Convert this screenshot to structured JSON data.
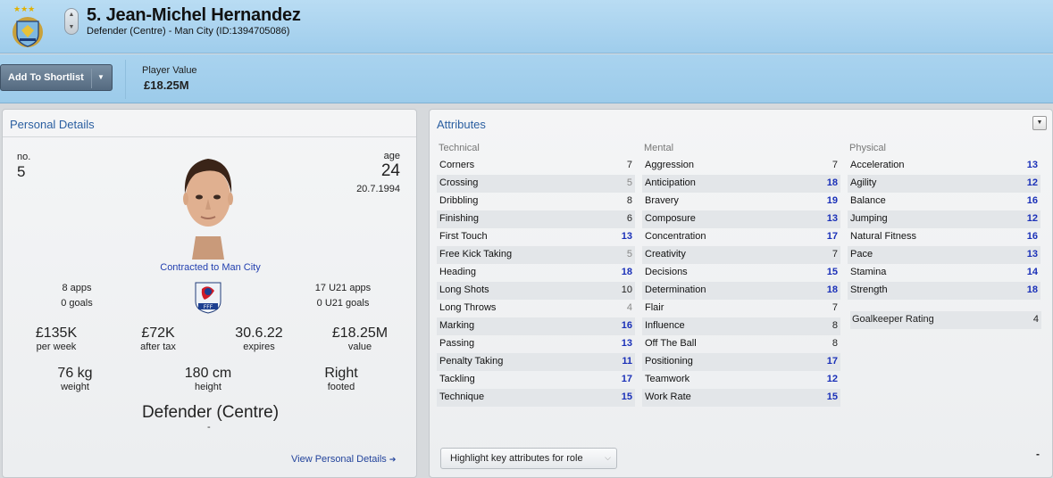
{
  "header": {
    "title": "5. Jean-Michel Hernandez",
    "subtitle": "Defender (Centre) - Man City (ID:1394705086)",
    "crest_icon": "club-crest-icon"
  },
  "toolbar": {
    "shortlist_label": "Add To Shortlist",
    "player_value_label": "Player Value",
    "player_value": "£18.25M"
  },
  "personal": {
    "title": "Personal Details",
    "no_label": "no.",
    "no_value": "5",
    "age_label": "age",
    "age_value": "24",
    "dob": "20.7.1994",
    "contract": "Contracted to Man City",
    "apps": "8 apps",
    "goals": "0 goals",
    "u21_apps": "17 U21 apps",
    "u21_goals": "0 U21 goals",
    "stats": [
      {
        "value": "£135K",
        "caption": "per week"
      },
      {
        "value": "£72K",
        "caption": "after tax"
      },
      {
        "value": "30.6.22",
        "caption": "expires"
      },
      {
        "value": "£18.25M",
        "caption": "value"
      }
    ],
    "physical": [
      {
        "value": "76 kg",
        "caption": "weight"
      },
      {
        "value": "180 cm",
        "caption": "height"
      },
      {
        "value": "Right",
        "caption": "footed"
      }
    ],
    "role": "Defender (Centre)",
    "role_sub": "-",
    "view_link": "View Personal Details",
    "federation_badge": "FFF"
  },
  "attributes": {
    "title": "Attributes",
    "technical": {
      "heading": "Technical",
      "rows": [
        {
          "name": "Corners",
          "value": "7"
        },
        {
          "name": "Crossing",
          "value": "5"
        },
        {
          "name": "Dribbling",
          "value": "8"
        },
        {
          "name": "Finishing",
          "value": "6"
        },
        {
          "name": "First Touch",
          "value": "13"
        },
        {
          "name": "Free Kick Taking",
          "value": "5"
        },
        {
          "name": "Heading",
          "value": "18"
        },
        {
          "name": "Long Shots",
          "value": "10"
        },
        {
          "name": "Long Throws",
          "value": "4"
        },
        {
          "name": "Marking",
          "value": "16"
        },
        {
          "name": "Passing",
          "value": "13"
        },
        {
          "name": "Penalty Taking",
          "value": "11"
        },
        {
          "name": "Tackling",
          "value": "17"
        },
        {
          "name": "Technique",
          "value": "15"
        }
      ]
    },
    "mental": {
      "heading": "Mental",
      "rows": [
        {
          "name": "Aggression",
          "value": "7"
        },
        {
          "name": "Anticipation",
          "value": "18"
        },
        {
          "name": "Bravery",
          "value": "19"
        },
        {
          "name": "Composure",
          "value": "13"
        },
        {
          "name": "Concentration",
          "value": "17"
        },
        {
          "name": "Creativity",
          "value": "7"
        },
        {
          "name": "Decisions",
          "value": "15"
        },
        {
          "name": "Determination",
          "value": "18"
        },
        {
          "name": "Flair",
          "value": "7"
        },
        {
          "name": "Influence",
          "value": "8"
        },
        {
          "name": "Off The Ball",
          "value": "8"
        },
        {
          "name": "Positioning",
          "value": "17"
        },
        {
          "name": "Teamwork",
          "value": "12"
        },
        {
          "name": "Work Rate",
          "value": "15"
        }
      ]
    },
    "physical": {
      "heading": "Physical",
      "rows": [
        {
          "name": "Acceleration",
          "value": "13"
        },
        {
          "name": "Agility",
          "value": "12"
        },
        {
          "name": "Balance",
          "value": "16"
        },
        {
          "name": "Jumping",
          "value": "12"
        },
        {
          "name": "Natural Fitness",
          "value": "16"
        },
        {
          "name": "Pace",
          "value": "13"
        },
        {
          "name": "Stamina",
          "value": "14"
        },
        {
          "name": "Strength",
          "value": "18"
        }
      ]
    },
    "goalkeeper_label": "Goalkeeper Rating",
    "goalkeeper_value": "4",
    "highlight_label": "Highlight key attributes for role",
    "corner_mark": "-"
  }
}
